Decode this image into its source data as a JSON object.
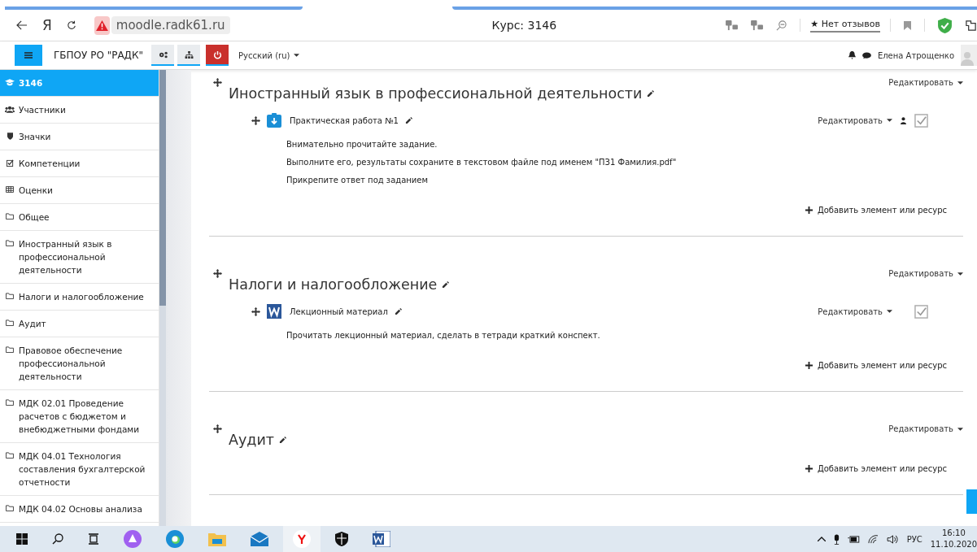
{
  "browser": {
    "logo_letter": "Я",
    "url": "moodle.radk61.ru",
    "title": "Курс: 3146",
    "reviews_star": "★",
    "reviews": "Нет отзывов"
  },
  "navbar": {
    "site_name": "ГБПОУ РО \"РАДК\"",
    "language": "Русский (ru)",
    "user_name": "Елена Атрощенко"
  },
  "sidebar": {
    "items": [
      {
        "label": "3146",
        "kind": "cap",
        "selected": true
      },
      {
        "label": "Участники",
        "kind": "users",
        "selected": false
      },
      {
        "label": "Значки",
        "kind": "shield",
        "selected": false
      },
      {
        "label": "Компетенции",
        "kind": "check",
        "selected": false
      },
      {
        "label": "Оценки",
        "kind": "table",
        "selected": false
      },
      {
        "label": "Общее",
        "kind": "folder",
        "selected": false
      },
      {
        "label": "Иностранный язык в профессиональной деятельности",
        "kind": "folder",
        "selected": false
      },
      {
        "label": "Налоги и налогообложение",
        "kind": "folder",
        "selected": false
      },
      {
        "label": "Аудит",
        "kind": "folder",
        "selected": false
      },
      {
        "label": "Правовое обеспечение профессиональной деятельности",
        "kind": "folder",
        "selected": false
      },
      {
        "label": "МДК 02.01 Проведение расчетов с бюджетом и внебюджетными фондами",
        "kind": "folder",
        "selected": false
      },
      {
        "label": "МДК 04.01 Технология составления бухгалтерской отчетности",
        "kind": "folder",
        "selected": false
      },
      {
        "label": "МДК 04.02 Основы анализа",
        "kind": "folder",
        "selected": false
      }
    ]
  },
  "sections": [
    {
      "title": "Иностранный язык в профессиональной деятельности",
      "edit": "Редактировать",
      "activities": [
        {
          "kind": "assign",
          "name": "Практическая работа №1",
          "edit": "Редактировать",
          "group_icon": true,
          "completion_enabled": true,
          "description": [
            "Внимательно прочитайте задание.",
            "Выполните его, результаты сохраните в текстовом файле под именем \"ПЗ1 Фамилия.pdf\"",
            "Прикрепите ответ под заданием"
          ]
        }
      ],
      "add": "Добавить элемент или ресурс"
    },
    {
      "title": "Налоги и налогообложение",
      "edit": "Редактировать",
      "activities": [
        {
          "kind": "word",
          "name": "Лекционный материал",
          "edit": "Редактировать",
          "group_icon": false,
          "completion_enabled": true,
          "description": [
            "Прочитать лекционный материал, сделать в тетради краткий конспект."
          ]
        }
      ],
      "add": "Добавить элемент или ресурс"
    },
    {
      "title": "Аудит",
      "edit": "Редактировать",
      "add": "Добавить элемент или ресурс"
    }
  ],
  "taskbar": {
    "language": "РУС",
    "time": "16:10",
    "date": "11.10.2020"
  }
}
